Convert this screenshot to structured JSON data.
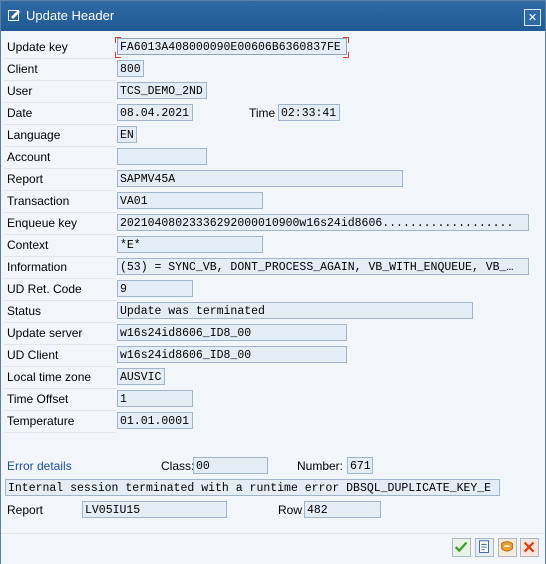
{
  "window": {
    "title": "Update Header"
  },
  "fields": {
    "update_key": {
      "label": "Update key",
      "value": "FA6013A408000090E00606B6360837FE"
    },
    "client": {
      "label": "Client",
      "value": "800"
    },
    "user": {
      "label": "User",
      "value": "TCS_DEMO_2ND"
    },
    "date": {
      "label": "Date",
      "value": "08.04.2021"
    },
    "time": {
      "label": "Time",
      "value": "02:33:41"
    },
    "language": {
      "label": "Language",
      "value": "EN"
    },
    "account": {
      "label": "Account",
      "value": ""
    },
    "report": {
      "label": "Report",
      "value": "SAPMV45A"
    },
    "transaction": {
      "label": "Transaction",
      "value": "VA01"
    },
    "enqueue_key": {
      "label": "Enqueue key",
      "value": "20210408023336292000010900w16s24id8606..................."
    },
    "context": {
      "label": "Context",
      "value": "*E*"
    },
    "information": {
      "label": "Information",
      "value": "(53) =  SYNC_VB, DONT_PROCESS_AGAIN, VB_WITH_ENQUEUE, VB_…"
    },
    "ud_ret_code": {
      "label": "UD Ret. Code",
      "value": "9"
    },
    "status": {
      "label": "Status",
      "value": "Update was terminated"
    },
    "update_server": {
      "label": "Update server",
      "value": "w16s24id8606_ID8_00"
    },
    "ud_client": {
      "label": "UD Client",
      "value": "w16s24id8606_ID8_00"
    },
    "local_time_zone": {
      "label": "Local time zone",
      "value": "AUSVIC"
    },
    "time_offset": {
      "label": "Time Offset",
      "value": "1"
    },
    "temperature": {
      "label": "Temperature",
      "value": "01.01.0001"
    }
  },
  "error": {
    "details_label": "Error details",
    "class_label": "Class:",
    "class_value": "00",
    "number_label": "Number:",
    "number_value": "671",
    "message": "Internal session terminated with a runtime error DBSQL_DUPLICATE_KEY_E",
    "report_label": "Report",
    "report_value": "LV05IU15",
    "row_label": "Row",
    "row_value": "482"
  },
  "toolbar": {
    "confirm_icon": "checkmark-icon",
    "details_icon": "document-list-icon",
    "debug_icon": "debugger-icon",
    "cancel_icon": "cancel-x-icon"
  },
  "colors": {
    "titlebar": "#1f5a96",
    "field_bg": "#e4edf5",
    "link_blue": "#1c4fa0",
    "confirm_green": "#3c9a2a",
    "cancel_red": "#d8401c"
  }
}
